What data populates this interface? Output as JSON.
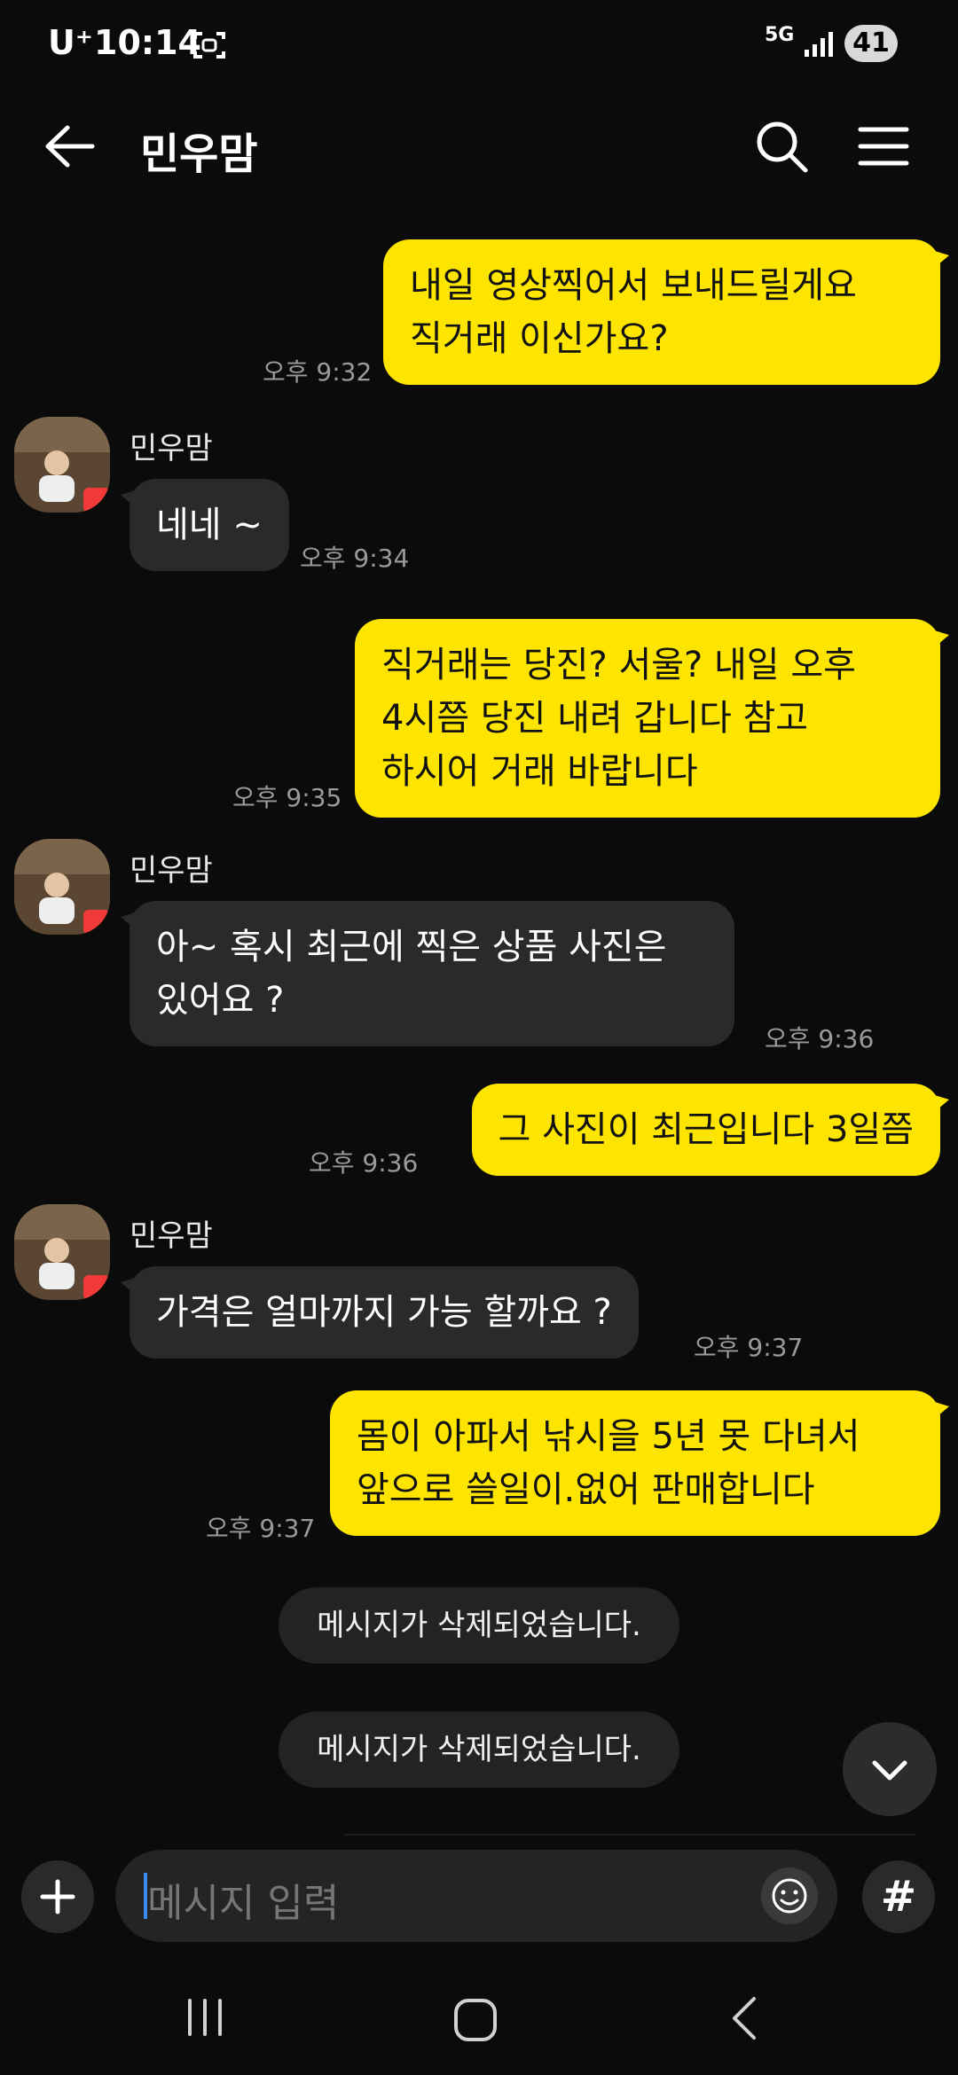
{
  "status_bar": {
    "carrier": "U⁺",
    "time": "10:14",
    "network": "5G",
    "battery": "41"
  },
  "header": {
    "title": "민우맘"
  },
  "messages": [
    {
      "text": "내일 영상찍어서 보내드릴게요\n직거래 이신가요?",
      "time": "오후 9:32"
    },
    {
      "sender": "민우맘",
      "text": "네네 ~",
      "time": "오후 9:34"
    },
    {
      "text": "직거래는 당진? 서울? 내일 오후\n4시쯤 당진 내려 갑니다 참고\n하시어 거래 바랍니다",
      "time": "오후 9:35"
    },
    {
      "sender": "민우맘",
      "text": "아~ 혹시  최근에 찍은 상품 사진은\n있어요 ?",
      "time": "오후 9:36"
    },
    {
      "text": "그 사진이 최근입니다 3일쯤",
      "time": "오후 9:36"
    },
    {
      "sender": "민우맘",
      "text": "가격은 얼마까지 가능 할까요 ?",
      "time": "오후 9:37"
    },
    {
      "text": "몸이 아파서 낚시을 5년 못 다녀서\n앞으로 쓸일이.없어 판매합니다",
      "time": "오후 9:37"
    }
  ],
  "deleted": [
    "메시지가 삭제되었습니다.",
    "메시지가 삭제되었습니다."
  ],
  "input": {
    "placeholder": "메시지 입력"
  },
  "icons": {
    "back": "arrow-left-icon",
    "search": "search-icon",
    "menu": "hamburger-menu-icon",
    "plus": "plus-icon",
    "emoji": "emoji-icon",
    "hash": "#",
    "scroll": "chevron-down-icon"
  },
  "colors": {
    "outgoing": "#fee500",
    "incoming": "#2a2a2a",
    "background": "#0b0b0b"
  }
}
